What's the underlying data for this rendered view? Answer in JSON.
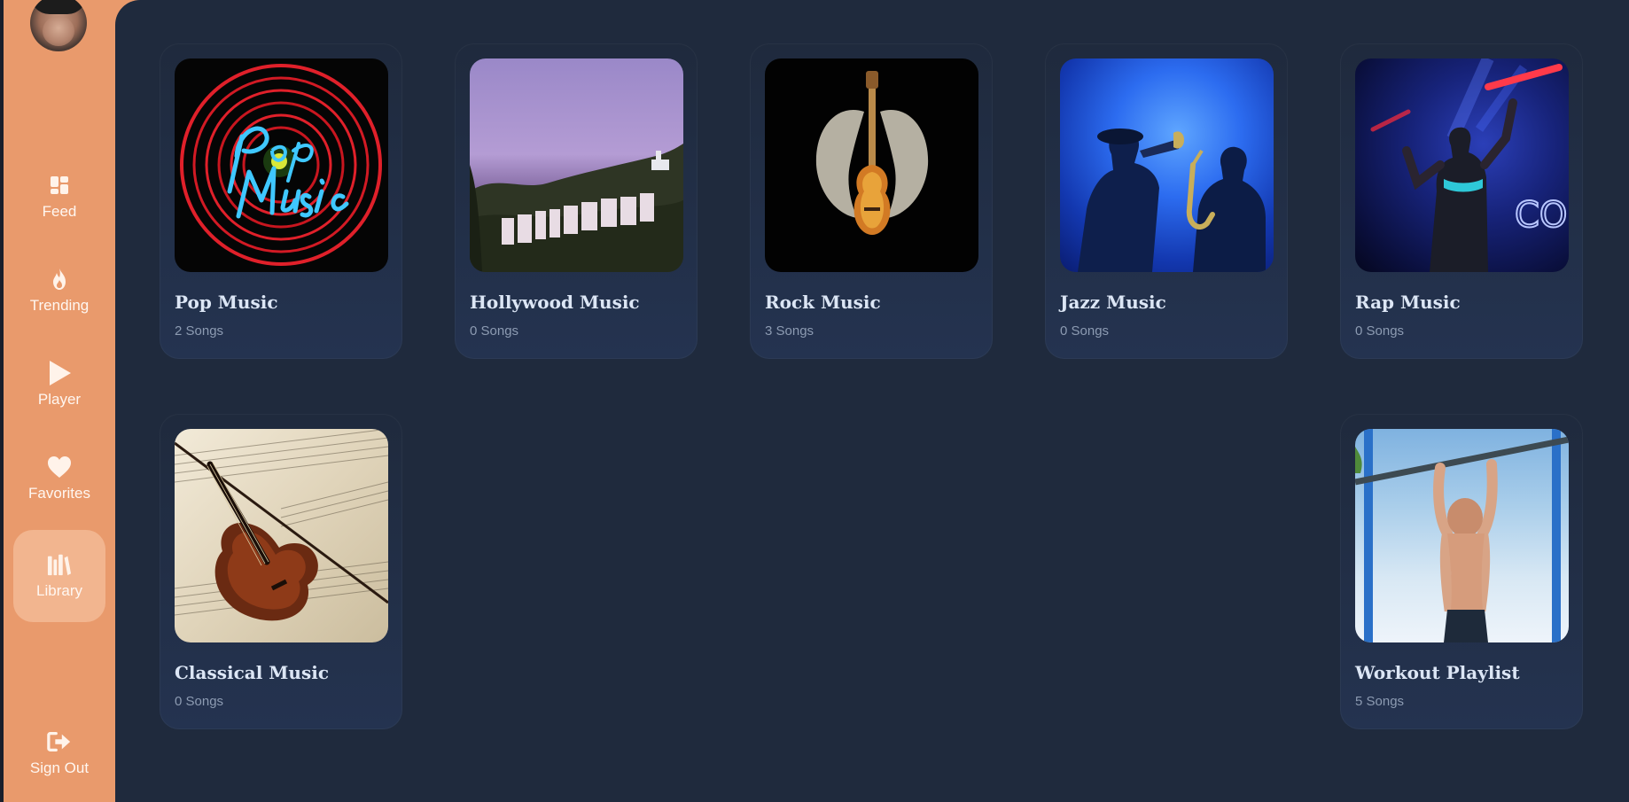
{
  "sidebar": {
    "items": [
      {
        "label": "Feed",
        "icon": "grid-icon"
      },
      {
        "label": "Trending",
        "icon": "flame-icon"
      },
      {
        "label": "Player",
        "icon": "play-icon"
      },
      {
        "label": "Favorites",
        "icon": "heart-icon"
      },
      {
        "label": "Library",
        "icon": "library-icon",
        "active": true
      }
    ],
    "sign_out": {
      "label": "Sign Out",
      "icon": "sign-out-icon"
    }
  },
  "library": {
    "cards": [
      {
        "title": "Pop Music",
        "count": "2 Songs"
      },
      {
        "title": "Hollywood Music",
        "count": "0 Songs"
      },
      {
        "title": "Rock Music",
        "count": "3 Songs"
      },
      {
        "title": "Jazz Music",
        "count": "0 Songs"
      },
      {
        "title": "Rap Music",
        "count": "0 Songs"
      },
      {
        "title": "Classical Music",
        "count": "0 Songs"
      },
      {
        "title": "Workout Playlist",
        "count": "5 Songs"
      }
    ]
  },
  "colors": {
    "sidebar_bg": "#e99a6c",
    "main_bg": "#1f2a3d",
    "active_item_bg": "#f2b58f",
    "card_title": "#dce6f5",
    "card_count": "#8d9bb2"
  }
}
